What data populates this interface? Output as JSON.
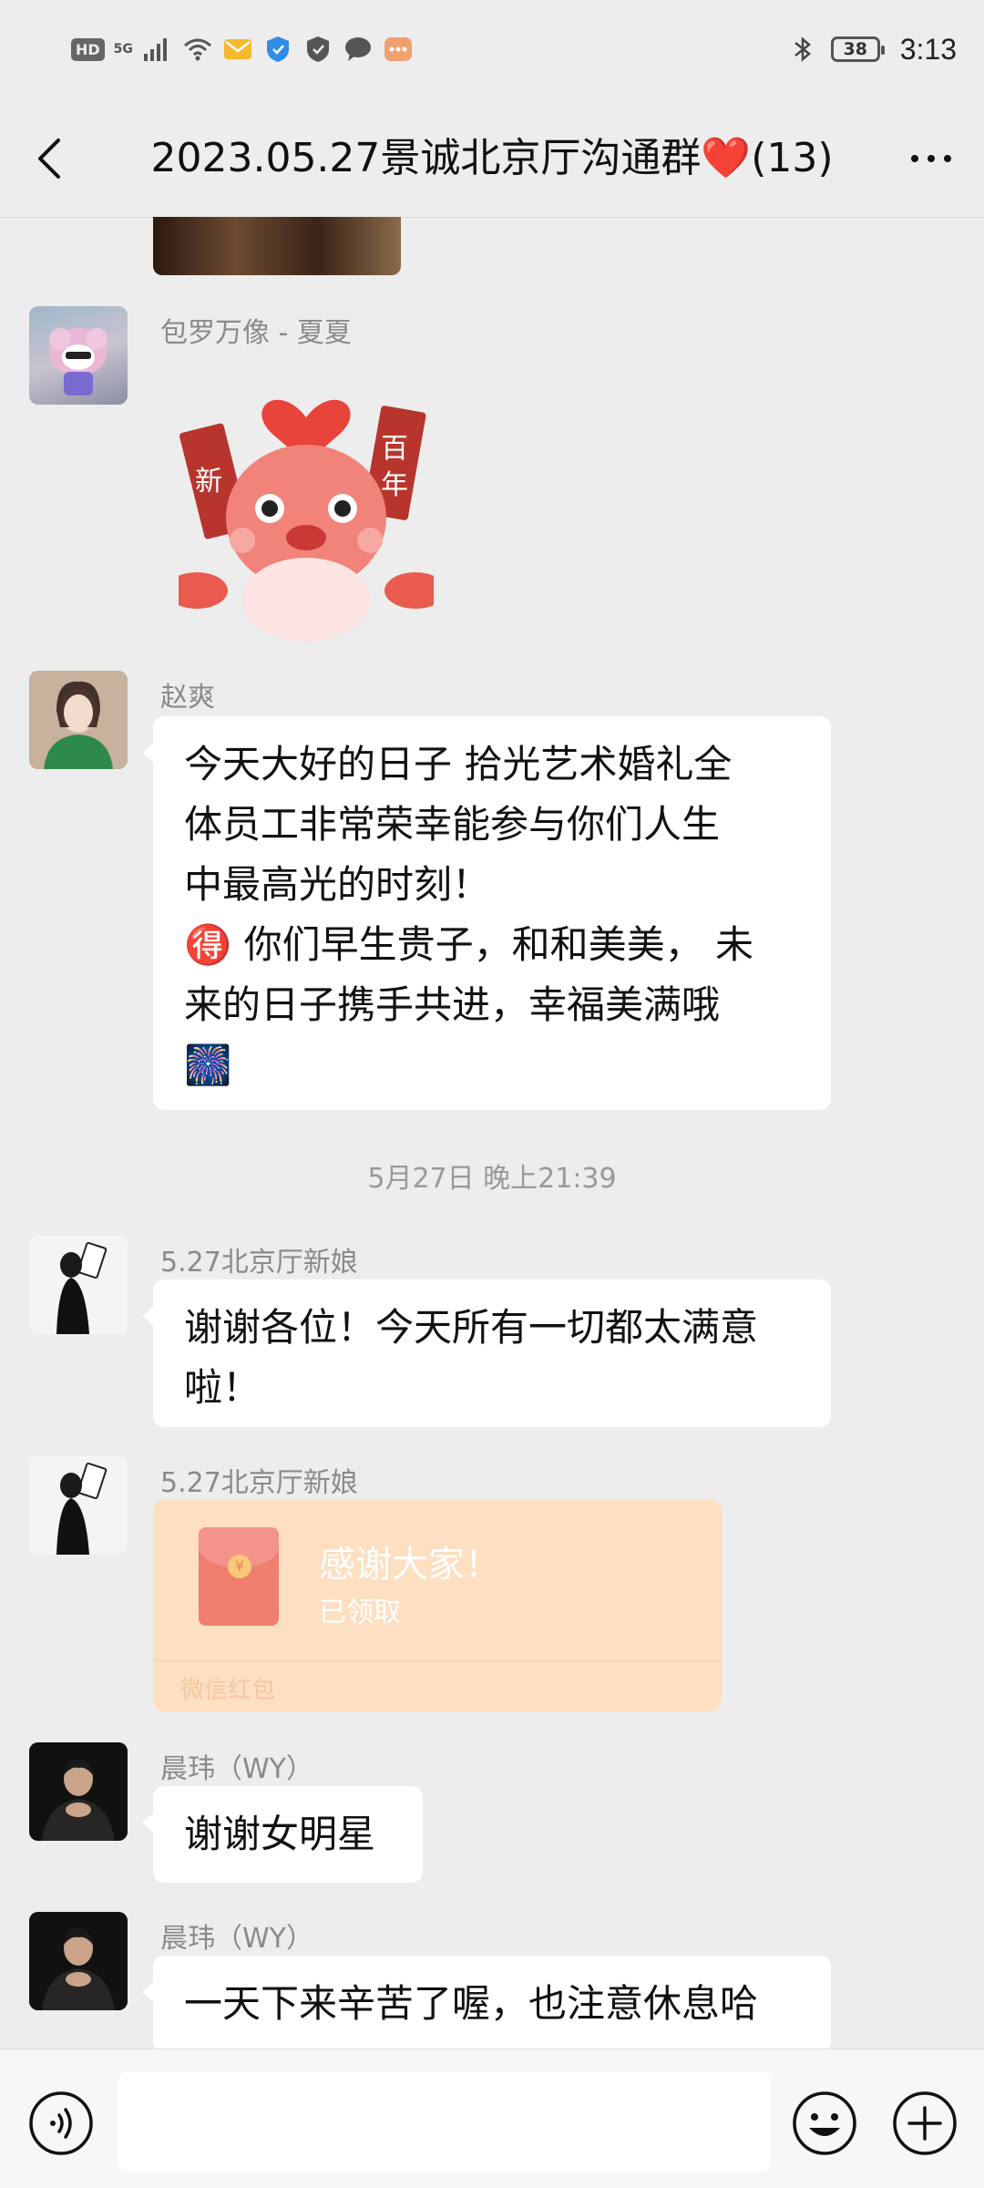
{
  "status_bar": {
    "hd": "HD",
    "network": "5G",
    "battery": "38",
    "time": "3:13",
    "icons": [
      "signal-icon",
      "wifi-icon",
      "mail-icon",
      "shield-blue-icon",
      "shield-icon",
      "chat-bubble-icon",
      "message-icon",
      "bluetooth-icon"
    ]
  },
  "header": {
    "title": "2023.05.27景诚北京厅沟通群❤️(13)"
  },
  "messages": [
    {
      "sender": "包罗万像 - 夏夏",
      "type": "sticker"
    },
    {
      "sender": "赵爽",
      "lines": [
        "今天大好的日子 拾光艺术婚礼全",
        "体员工非常荣幸能参与你们人生",
        "中最高光的时刻！",
        "🉐 你们早生贵子，和和美美， 未",
        "来的日子携手共进，幸福美满哦",
        "🎆"
      ]
    },
    {
      "timestamp": "5月27日 晚上21:39"
    },
    {
      "sender": "5.27北京厅新娘",
      "lines": [
        "谢谢各位！今天所有一切都太满意",
        "啦！"
      ]
    },
    {
      "sender": "5.27北京厅新娘",
      "type": "red_packet",
      "title": "感谢大家！",
      "status": "已领取",
      "label": "微信红包"
    },
    {
      "sender": "晨玮（WY）",
      "lines": [
        "谢谢女明星"
      ]
    },
    {
      "sender": "晨玮（WY）",
      "lines": [
        "一天下来辛苦了喔，也注意休息哈"
      ]
    }
  ],
  "colors": {
    "background": "#ededed",
    "bubble": "#ffffff",
    "red_packet": "#fddfc1"
  }
}
